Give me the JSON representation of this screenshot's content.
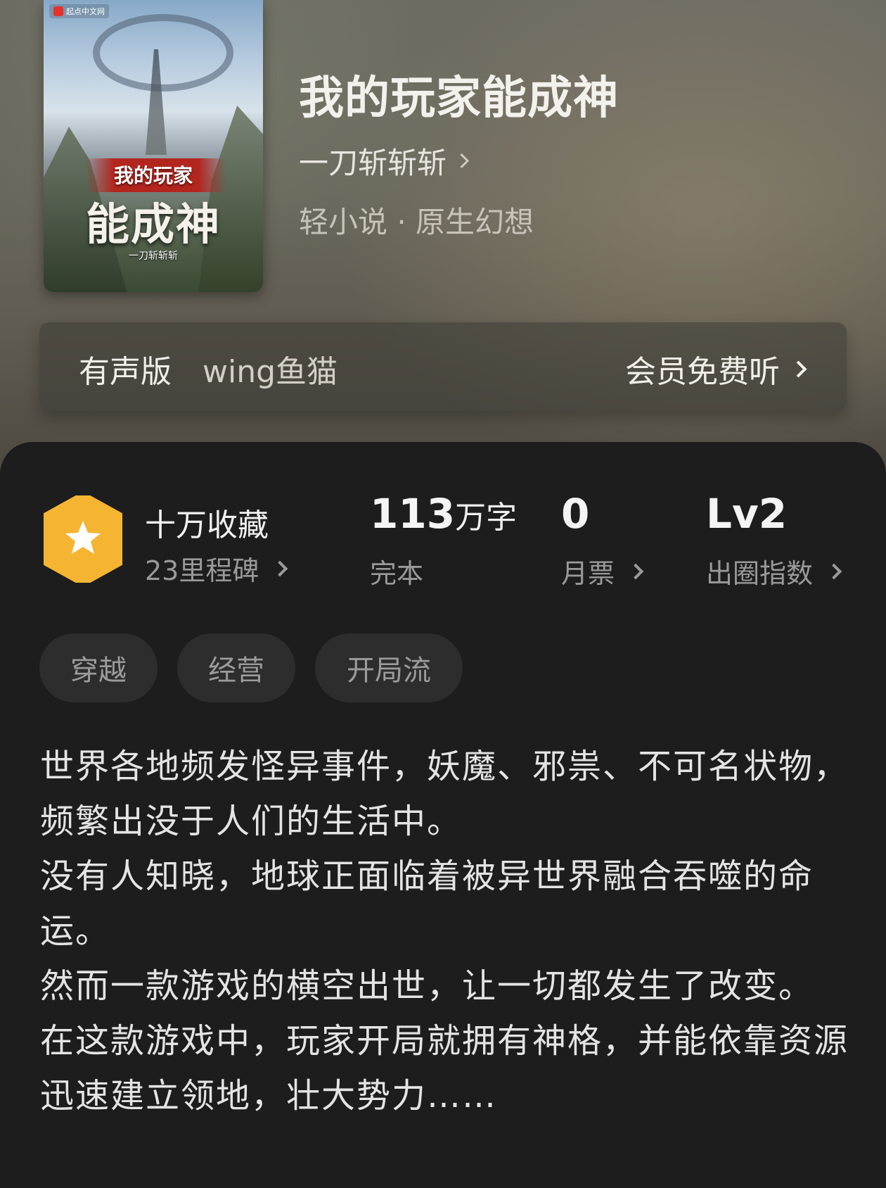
{
  "cover": {
    "logo_text": "起点中文网",
    "title_line1": "我的玩家",
    "title_line2": "能成神",
    "author_small": "一刀斩斩斩"
  },
  "book": {
    "title": "我的玩家能成神",
    "author": "一刀斩斩斩",
    "genre": "轻小说 · 原生幻想"
  },
  "audio": {
    "label": "有声版",
    "narrator": "wing鱼猫",
    "cta": "会员免费听"
  },
  "stats": {
    "favorites": "十万收藏",
    "milestones": "23里程碑",
    "word_count": "113",
    "word_unit": "万字",
    "status": "完本",
    "monthly_votes": "0",
    "monthly_votes_label": "月票",
    "level": "Lv2",
    "level_label": "出圈指数"
  },
  "tags": [
    "穿越",
    "经营",
    "开局流"
  ],
  "description": [
    "世界各地频发怪异事件，妖魔、邪祟、不可名状物，频繁出没于人们的生活中。",
    "没有人知晓，地球正面临着被异世界融合吞噬的命运。",
    "然而一款游戏的横空出世，让一切都发生了改变。",
    "在这款游戏中，玩家开局就拥有神格，并能依靠资源迅速建立领地，壮大势力……"
  ],
  "colors": {
    "badge": "#f5b533",
    "panel": "#1d1d1d",
    "tag_bg": "#2d2d2d"
  }
}
